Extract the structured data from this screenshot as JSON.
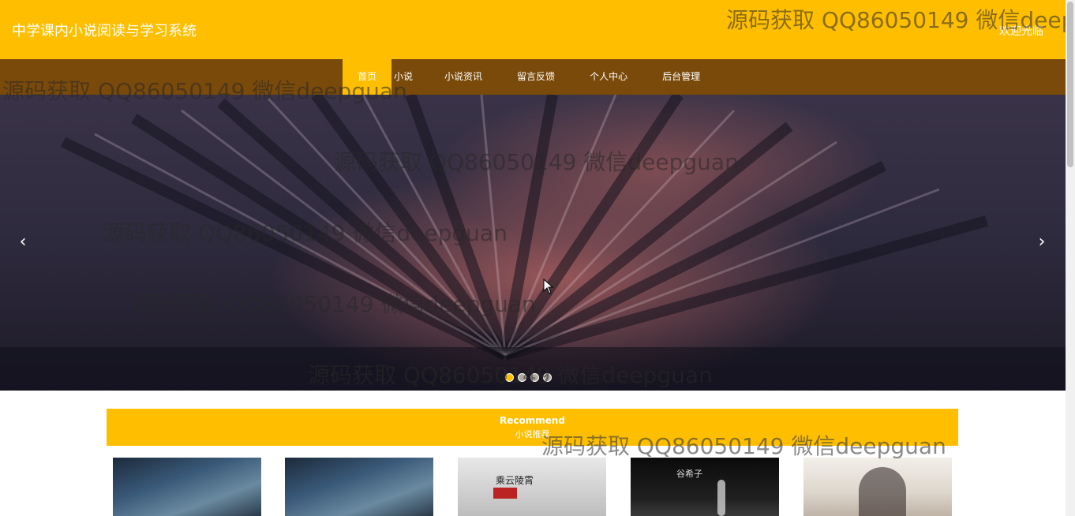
{
  "header": {
    "site_title": "中学课内小说阅读与学习系统",
    "welcome": "欢迎光临"
  },
  "nav": {
    "items": [
      "首页",
      "小说",
      "小说资讯",
      "留言反馈",
      "个人中心",
      "后台管理"
    ],
    "active_index": 0
  },
  "carousel": {
    "prev_glyph": "‹",
    "next_glyph": "›",
    "dot_count": 4,
    "active_dot": 0
  },
  "recommend": {
    "title_en": "Recommend",
    "title_cn": "小说推荐"
  },
  "books": [
    {
      "cover_text": ""
    },
    {
      "cover_text": ""
    },
    {
      "cover_text": "乘云陵霄"
    },
    {
      "cover_text": "谷希子"
    },
    {
      "cover_text": ""
    }
  ],
  "watermark": {
    "text": "源码获取 QQ86050149 微信deepguan"
  },
  "colors": {
    "accent": "#ffbf00",
    "nav_bg": "#7a4a0a"
  }
}
